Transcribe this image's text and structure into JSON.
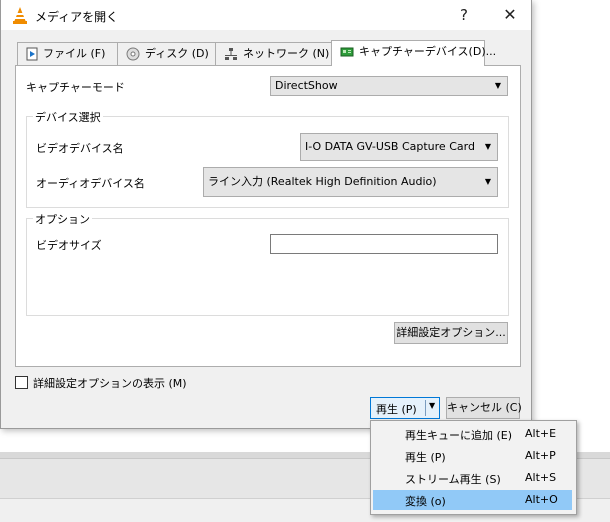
{
  "dialog": {
    "title": "メディアを開く",
    "help_glyph": "?",
    "close_glyph": "✕"
  },
  "tabs": [
    {
      "label": "ファイル (F)"
    },
    {
      "label": "ディスク (D)"
    },
    {
      "label": "ネットワーク (N)"
    },
    {
      "label": "キャプチャーデバイス(D)..."
    }
  ],
  "capture": {
    "mode_label": "キャプチャーモード",
    "mode_value": "DirectShow",
    "device_group": "デバイス選択",
    "video_device_label": "ビデオデバイス名",
    "video_device_value": "I-O DATA GV-USB Capture Card",
    "audio_device_label": "オーディオデバイス名",
    "audio_device_value": "ライン入力 (Realtek High Definition Audio)",
    "options_group": "オプション",
    "video_size_label": "ビデオサイズ",
    "video_size_value": "",
    "advanced_button": "詳細設定オプション..."
  },
  "footer": {
    "show_advanced_label": "詳細設定オプションの表示 (M)",
    "play_button": "再生 (P)",
    "cancel_button": "キャンセル (C)"
  },
  "menu": {
    "items": [
      {
        "label": "再生キューに追加 (E)",
        "accel": "Alt+E"
      },
      {
        "label": "再生 (P)",
        "accel": "Alt+P"
      },
      {
        "label": "ストリーム再生 (S)",
        "accel": "Alt+S"
      },
      {
        "label": "変換 (o)",
        "accel": "Alt+O"
      }
    ],
    "highlighted_index": 3
  },
  "colors": {
    "accent": "#0078d7",
    "menu_highlight": "#91c9f7",
    "vlc_orange": "#f08c00"
  }
}
